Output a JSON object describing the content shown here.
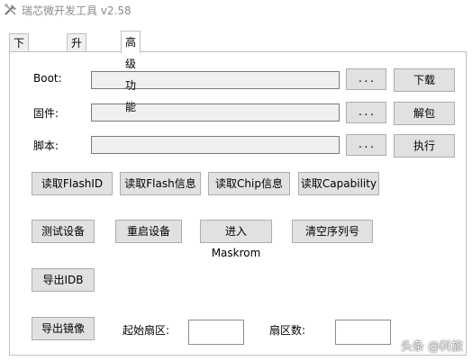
{
  "window": {
    "title": "瑞芯微开发工具 v2.58"
  },
  "tabs": [
    {
      "label": "下载镜像"
    },
    {
      "label": "升级固件"
    },
    {
      "label": "高级功能",
      "active": true
    }
  ],
  "rows": {
    "boot": {
      "label": "Boot:",
      "value": "",
      "browse": "...",
      "action": "下载"
    },
    "firmware": {
      "label": "固件:",
      "value": "",
      "browse": "...",
      "action": "解包"
    },
    "script": {
      "label": "脚本:",
      "value": "",
      "browse": "...",
      "action": "执行"
    }
  },
  "buttons": {
    "read_flash_id": "读取FlashID",
    "read_flash_info": "读取Flash信息",
    "read_chip_info": "读取Chip信息",
    "read_capability": "读取Capability",
    "test_device": "测试设备",
    "reboot_device": "重启设备",
    "enter_maskrom": "进入Maskrom",
    "clear_serial": "清空序列号",
    "export_idb": "导出IDB",
    "export_image": "导出镜像"
  },
  "export": {
    "start_sector_label": "起始扇区:",
    "start_sector_value": "",
    "sector_count_label": "扇区数:",
    "sector_count_value": ""
  },
  "watermark": "头条 @科旅"
}
